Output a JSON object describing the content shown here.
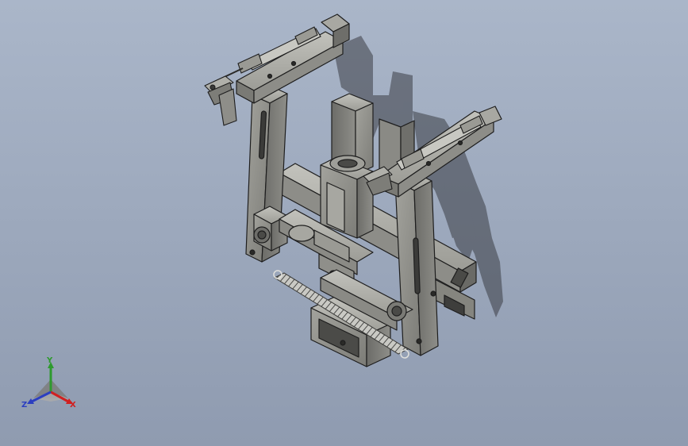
{
  "viewport": {
    "background_top": "#aab6c9",
    "background_bottom": "#8f9bb0"
  },
  "model": {
    "part_color": "#8b8b87",
    "part_shadow": "#5f5f5c",
    "part_highlight": "#b4b4ae",
    "edge_color": "#1e1e1e"
  },
  "triad": {
    "x_label": "X",
    "y_label": "Y",
    "z_label": "Z",
    "x_color": "#d02020",
    "y_color": "#2e9a2e",
    "z_color": "#2c3fc0"
  }
}
